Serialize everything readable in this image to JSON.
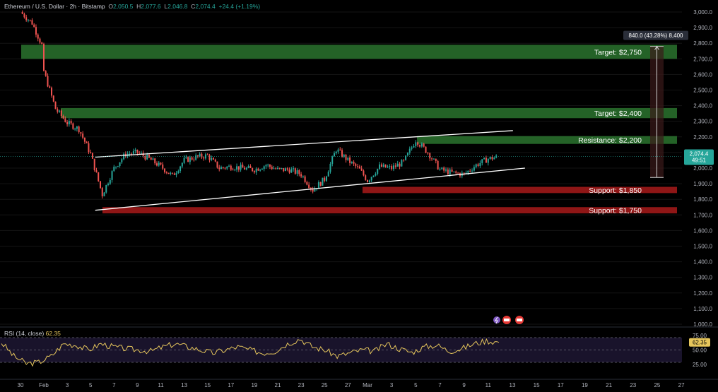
{
  "header": {
    "symbol": "Ethereum / U.S. Dollar · 2h · Bitstamp",
    "o_label": "O",
    "o_value": "2,050.5",
    "h_label": "H",
    "h_value": "2,077.6",
    "l_label": "L",
    "l_value": "2,046.8",
    "c_label": "C",
    "c_value": "2,074.4",
    "change": "+24.4 (+1.19%)"
  },
  "rsi_header": {
    "label": "RSI (14, close)",
    "value": "62.35"
  },
  "price_axis": {
    "ticks": [
      "3,000.0",
      "2,900.0",
      "2,800.0",
      "2,700.0",
      "2,600.0",
      "2,500.0",
      "2,400.0",
      "2,300.0",
      "2,200.0",
      "2,100.0",
      "2,000.0",
      "1,900.0",
      "1,800.0",
      "1,700.0",
      "1,600.0",
      "1,500.0",
      "1,400.0",
      "1,300.0",
      "1,200.0",
      "1,100.0",
      "1,000.0"
    ],
    "current_price": "2,074.4",
    "countdown": "49:51"
  },
  "rsi_axis": {
    "ticks": [
      "75.00",
      "50.00",
      "25.00"
    ],
    "current": "62.35"
  },
  "time_axis": {
    "labels": [
      "30",
      "Feb",
      "3",
      "5",
      "7",
      "9",
      "11",
      "13",
      "15",
      "17",
      "19",
      "21",
      "23",
      "25",
      "27",
      "Mar",
      "3",
      "5",
      "7",
      "9",
      "11",
      "13",
      "15",
      "17",
      "19",
      "21",
      "23",
      "25",
      "27"
    ]
  },
  "measure": {
    "label": "840.0 (43.28%) 8,400"
  },
  "colors": {
    "bg": "#000000",
    "up": "#26a69a",
    "down": "#ef5350",
    "zone_green": "#2e7d32",
    "zone_red": "#b71c1c",
    "rsi_line": "#e6c65c"
  },
  "chart_data": {
    "type": "candlestick",
    "title": "Ethereum / U.S. Dollar · 2h · Bitstamp",
    "ylim": [
      1000,
      3000
    ],
    "zones": [
      {
        "label": "Target: $2,750",
        "low": 2700,
        "high": 2790,
        "kind": "target"
      },
      {
        "label": "Target: $2,400",
        "low": 2320,
        "high": 2385,
        "kind": "target"
      },
      {
        "label": "Resistance: $2,200",
        "low": 2155,
        "high": 2205,
        "kind": "resistance"
      },
      {
        "label": "Support: $1,850",
        "low": 1840,
        "high": 1880,
        "kind": "support"
      },
      {
        "label": "Support: $1,750",
        "low": 1710,
        "high": 1750,
        "kind": "support"
      }
    ],
    "channel": {
      "upper": [
        [
          "Feb 6",
          2070
        ],
        [
          "Mar 11",
          2240
        ]
      ],
      "lower": [
        [
          "Feb 6",
          1730
        ],
        [
          "Mar 12",
          2000
        ]
      ]
    },
    "measure": {
      "from": 1940,
      "to": 2780,
      "change": 840.0,
      "pct": 43.28
    },
    "close_path": [
      [
        "Jan 29",
        3000
      ],
      [
        "Jan 30",
        2930
      ],
      [
        "Jan 31",
        2760
      ],
      [
        "Feb 1",
        2620
      ],
      [
        "Feb 2",
        2380
      ],
      [
        "Feb 3",
        2290
      ],
      [
        "Feb 4",
        2250
      ],
      [
        "Feb 5",
        2090
      ],
      [
        "Feb 6",
        1830
      ],
      [
        "Feb 7",
        2000
      ],
      [
        "Feb 8",
        2090
      ],
      [
        "Feb 9",
        2100
      ],
      [
        "Feb 10",
        2060
      ],
      [
        "Feb 11",
        2010
      ],
      [
        "Feb 12",
        1950
      ],
      [
        "Feb 13",
        2050
      ],
      [
        "Feb 14",
        2070
      ],
      [
        "Feb 15",
        2080
      ],
      [
        "Feb 16",
        2000
      ],
      [
        "Feb 17",
        2010
      ],
      [
        "Feb 18",
        2000
      ],
      [
        "Feb 19",
        1990
      ],
      [
        "Feb 20",
        2020
      ],
      [
        "Feb 21",
        1990
      ],
      [
        "Feb 22",
        1990
      ],
      [
        "Feb 23",
        1960
      ],
      [
        "Feb 24",
        1860
      ],
      [
        "Feb 25",
        1930
      ],
      [
        "Feb 26",
        2120
      ],
      [
        "Feb 27",
        2050
      ],
      [
        "Feb 28",
        1990
      ],
      [
        "Mar 1",
        1920
      ],
      [
        "Mar 2",
        2010
      ],
      [
        "Mar 3",
        2000
      ],
      [
        "Mar 4",
        2040
      ],
      [
        "Mar 5",
        2180
      ],
      [
        "Mar 6",
        2100
      ],
      [
        "Mar 7",
        1990
      ],
      [
        "Mar 8",
        1970
      ],
      [
        "Mar 9",
        1960
      ],
      [
        "Mar 10",
        2020
      ],
      [
        "Mar 11",
        2060
      ],
      [
        "Mar 12",
        2074.4
      ]
    ],
    "rsi": {
      "period": 14,
      "current": 62.35,
      "levels": [
        70,
        50,
        30
      ],
      "values": [
        [
          0,
          62
        ],
        [
          1,
          40
        ],
        [
          2,
          28
        ],
        [
          3,
          30
        ],
        [
          4,
          40
        ],
        [
          5,
          60
        ],
        [
          6,
          58
        ],
        [
          7,
          50
        ],
        [
          8,
          60
        ],
        [
          9,
          55
        ],
        [
          10,
          52
        ],
        [
          11,
          50
        ],
        [
          12,
          48
        ],
        [
          13,
          55
        ],
        [
          14,
          60
        ],
        [
          15,
          55
        ],
        [
          16,
          50
        ],
        [
          17,
          45
        ],
        [
          18,
          50
        ],
        [
          19,
          55
        ],
        [
          20,
          50
        ],
        [
          21,
          45
        ],
        [
          22,
          48
        ],
        [
          23,
          60
        ],
        [
          24,
          68
        ],
        [
          25,
          55
        ],
        [
          26,
          50
        ],
        [
          27,
          40
        ],
        [
          28,
          45
        ],
        [
          29,
          50
        ],
        [
          30,
          48
        ],
        [
          31,
          60
        ],
        [
          32,
          52
        ],
        [
          33,
          46
        ],
        [
          34,
          55
        ],
        [
          35,
          58
        ],
        [
          36,
          48
        ],
        [
          37,
          52
        ],
        [
          38,
          60
        ],
        [
          39,
          65
        ],
        [
          40,
          62.35
        ]
      ]
    }
  }
}
